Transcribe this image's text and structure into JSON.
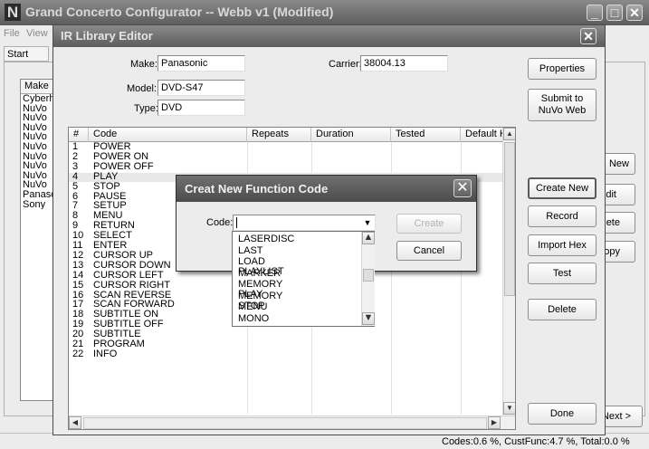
{
  "main_window": {
    "title": "Grand Concerto Configurator -- Webb v1 (Modified)",
    "menu": [
      "File",
      "View"
    ],
    "start_tab": "Start",
    "list_header": "Make",
    "list_items": [
      "Cyberh",
      "NuVo",
      "NuVo",
      "NuVo",
      "NuVo",
      "NuVo",
      "NuVo",
      "NuVo",
      "NuVo",
      "NuVo",
      "Panasc",
      "Sony"
    ],
    "side_buttons": [
      "New",
      "dit",
      "lete",
      "opy"
    ],
    "next_button": "Next >",
    "status": "Codes:0.6 %, CustFunc:4.7 %, Total:0.0 %"
  },
  "editor": {
    "title": "IR Library Editor",
    "make_label": "Make:",
    "make_value": "Panasonic",
    "model_label": "Model:",
    "model_value": "DVD-S47",
    "type_label": "Type:",
    "type_value": "DVD",
    "carrier_label": "Carrier:",
    "carrier_value": "38004.13",
    "columns": [
      "#",
      "Code",
      "Repeats",
      "Duration",
      "Tested",
      "Default K"
    ],
    "rows": [
      [
        "1",
        "POWER"
      ],
      [
        "2",
        "POWER ON"
      ],
      [
        "3",
        "POWER OFF"
      ],
      [
        "4",
        "PLAY"
      ],
      [
        "5",
        "STOP"
      ],
      [
        "6",
        "PAUSE"
      ],
      [
        "7",
        "SETUP"
      ],
      [
        "8",
        "MENU"
      ],
      [
        "9",
        "RETURN"
      ],
      [
        "10",
        "SELECT"
      ],
      [
        "11",
        "ENTER"
      ],
      [
        "12",
        "CURSOR UP"
      ],
      [
        "13",
        "CURSOR DOWN"
      ],
      [
        "14",
        "CURSOR LEFT"
      ],
      [
        "15",
        "CURSOR RIGHT"
      ],
      [
        "16",
        "SCAN REVERSE"
      ],
      [
        "17",
        "SCAN FORWARD"
      ],
      [
        "18",
        "SUBTITLE ON"
      ],
      [
        "19",
        "SUBTITLE OFF"
      ],
      [
        "20",
        "SUBTITLE"
      ],
      [
        "21",
        "PROGRAM"
      ],
      [
        "22",
        "INFO"
      ]
    ],
    "buttons": {
      "properties": "Properties",
      "submit": "Submit to NuVo Web",
      "create_new": "Create New",
      "record": "Record",
      "import_hex": "Import Hex",
      "test": "Test",
      "delete": "Delete",
      "done": "Done"
    }
  },
  "dialog": {
    "title": "Creat New Function Code",
    "code_label": "Code:",
    "code_value": "",
    "create_button": "Create",
    "cancel_button": "Cancel",
    "dropdown_options": [
      "LASERDISC",
      "LAST",
      "LOAD PLAYLIST",
      "MARKER",
      "MEMORY PLAY",
      "MEMORY STOP",
      "MENU",
      "MONO"
    ]
  }
}
